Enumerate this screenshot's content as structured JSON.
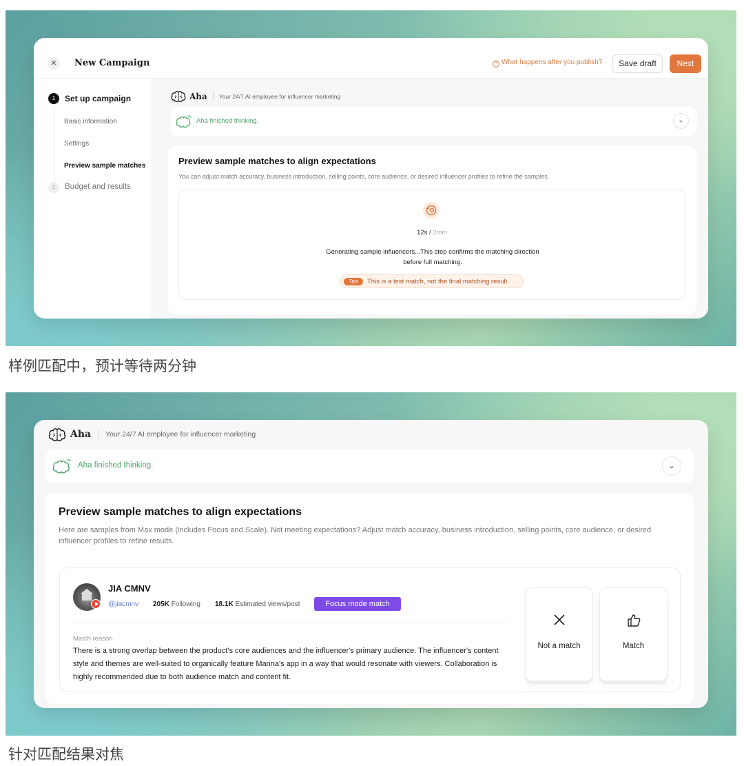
{
  "screens": {
    "first": {
      "app_title": "New Campaign",
      "help_link": "What happens after you publish?",
      "save_draft": "Save draft",
      "next": "Next",
      "steps": [
        {
          "number": "1",
          "label": "Set up campaign"
        },
        {
          "number": "2",
          "label": "Budget and results"
        }
      ],
      "sub_steps": [
        "Basic information",
        "Settings",
        "Preview sample matches"
      ],
      "assistant": {
        "name": "Aha",
        "tagline": "Your 24/7 AI employee for influencer marketing",
        "status": "Aha finished thinking."
      },
      "preview": {
        "title": "Preview sample matches to align expectations",
        "desc": "You can adjust match accuracy, business introduction, selling points, core audience, or desired influencer profiles to refine the samples.",
        "elapsed": "12s",
        "separator": " / ",
        "total": "2min",
        "message": "Generating sample influencers...This step confirms the matching direction before full matching.",
        "tips_badge": "Tips",
        "tips_text": "This is a test match, not the final matching result."
      }
    },
    "second": {
      "assistant": {
        "name": "Aha",
        "tagline": "Your 24/7 AI employee for influencer marketing",
        "status": "Aha finished thinking."
      },
      "preview": {
        "title": "Preview sample matches to align expectations",
        "desc": "Here are samples from Max mode (includes Focus and Scale). Not meeting expectations? Adjust match accuracy, business introduction, selling points, core audience, or desired influencer profiles to refine results."
      },
      "influencer": {
        "name": "JIA CMNV",
        "handle": "@jiacmnv",
        "following_value": "205K",
        "following_label": " Following",
        "views_value": "18.1K",
        "views_label": " Estimated views/post",
        "badge": "Focus mode match",
        "platform_icon": "youtube-icon",
        "reason_label": "Match reason",
        "reason_text": "There is a strong overlap between the product's core audiences and the influencer's primary audience. The influencer's content style and themes are well-suited to organically feature Manna's app in a way that would resonate with viewers. Collaboration is highly recommended due to both audience match and content fit."
      },
      "actions": {
        "not_match": "Not a match",
        "match": "Match"
      }
    }
  },
  "captions": [
    "样例匹配中，预计等待两分钟",
    "针对匹配结果对焦"
  ],
  "colors": {
    "accent": "#e2773d",
    "success": "#4fa36a",
    "focus_badge": "#7e4be7",
    "handle": "#5b7bd0"
  }
}
